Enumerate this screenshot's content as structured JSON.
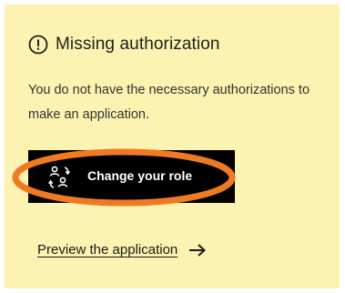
{
  "alert": {
    "icon": "exclamation-circle-icon",
    "title": "Missing authorization",
    "message": "You do not have the necessary authorizations to make an application."
  },
  "actions": {
    "change_role": {
      "icon": "switch-user-icon",
      "label": "Change your role"
    },
    "preview": {
      "label": "Preview the application",
      "icon": "arrow-right-icon"
    }
  },
  "colors": {
    "card_background": "#fcf2b1",
    "button_background": "#000000",
    "button_text": "#ffffff",
    "highlight_ring": "#f07a22",
    "text": "#1f1f1f"
  }
}
